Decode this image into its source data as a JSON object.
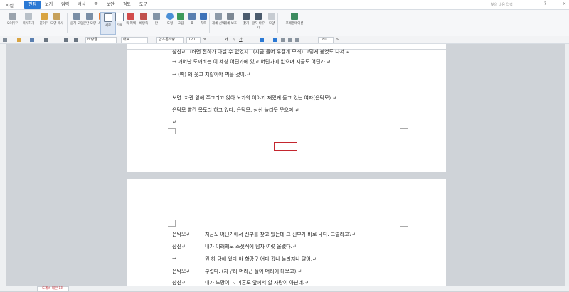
{
  "menubar": {
    "file": "파일",
    "menus": [
      "편집",
      "보기",
      "입력",
      "서식",
      "쪽",
      "보안",
      "검토",
      "도구"
    ],
    "active": "편집",
    "search_placeholder": "찾을 내용 입력"
  },
  "ribbon": {
    "buttons": [
      "오려두기",
      "복사하기",
      "붙이기",
      "모양 복사",
      "글자 모양",
      "문단 모양",
      "스타일",
      "세로",
      "가로",
      "쪽 여백",
      "바탕쪽",
      "단",
      "도형",
      "그림",
      "표",
      "차트",
      "개체 선택",
      "개체 보호",
      "찾기",
      "글자 바꾸기",
      "모양",
      "프레젠테이션"
    ],
    "selected": "세로"
  },
  "format_bar": {
    "style": "바탕글",
    "font_lang": "대표",
    "font": "함초롬바탕",
    "size": "12.0",
    "unit": "pt",
    "zoom": "180",
    "zoom_unit": "%"
  },
  "page1": {
    "lines": [
      "삼신↵          그러면 전하가 아닐 수 없었지.. (지금 들어 우걸개 모래) 그렇게 붙였도 나서 ↵",
      "→              깨어난 도깨비는 이 세상 어딘가에 있고 어딘가에 없으며 지금도 어딘가.↵",
      "→              (빡) 왜 웃고 지랄이야 벽을 것이.↵",
      "보면. 차관 앞에 쭈그리고 앉아 노가의 이야기 재밌게 듣고 있는 여자(은탁모).↵",
      "은탁모 빨간 목도리 하고 있다. 은탁모, 삼신 놀리듯 웃으며.↵",
      "↵"
    ]
  },
  "page2": {
    "lines": [
      {
        "speaker": "은탁모↵",
        "text": "지금도 어딘가에서 신부를 찾고 있는데 그 신부가 바로 나다. 그럴라고?↵"
      },
      {
        "speaker": "삼신↵",
        "text": "내가 이래봬도 소싯적에 남자 여럿 울렸다.↵"
      },
      {
        "speaker": "→",
        "text": "뭔 하 담에 웠다 야 할망구 어다 갔나 놀라지나 말어.↵"
      },
      {
        "speaker": "은탁모↵",
        "text": "부럽다. (자구러 머리끈 풀어 머리에 대보고).↵"
      },
      {
        "speaker": "삼신↵",
        "text": "내가 노망이다. 미혼모 앞에서 할 자랑이 아닌데.↵"
      }
    ]
  },
  "statusbar": {
    "tab": "도깨비 대본 1화"
  },
  "colors": {
    "accent": "#2b79d4",
    "highlight_box": "#c4262e"
  }
}
